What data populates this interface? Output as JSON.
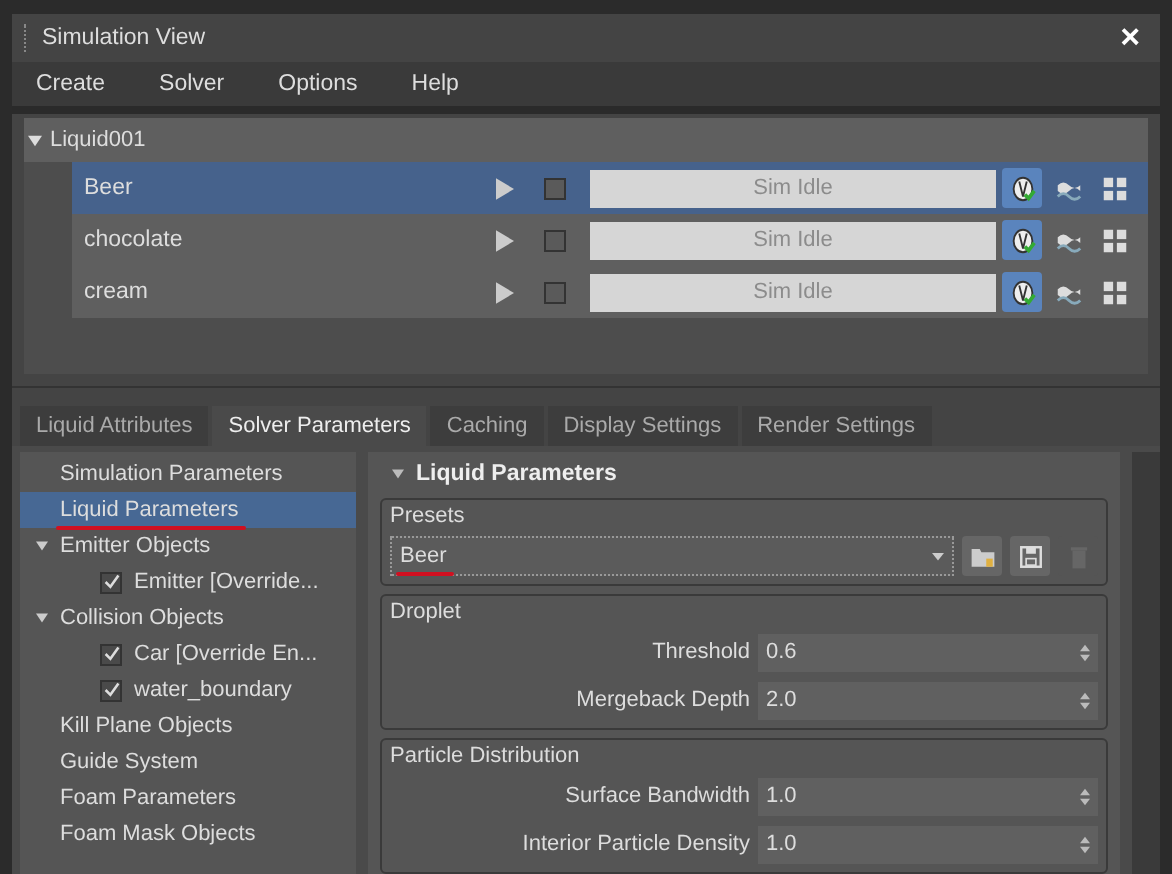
{
  "window": {
    "title": "Simulation View",
    "close": "×"
  },
  "menu": [
    "Create",
    "Solver",
    "Options",
    "Help"
  ],
  "tree": {
    "root": "Liquid001",
    "expanded": true,
    "rows": [
      {
        "name": "Beer",
        "selected": true,
        "checked": false,
        "status": "Sim Idle"
      },
      {
        "name": "chocolate",
        "selected": false,
        "checked": false,
        "status": "Sim Idle"
      },
      {
        "name": "cream",
        "selected": false,
        "checked": false,
        "status": "Sim Idle"
      }
    ]
  },
  "tabs": [
    {
      "label": "Liquid Attributes",
      "selected": false
    },
    {
      "label": "Solver Parameters",
      "selected": true
    },
    {
      "label": "Caching",
      "selected": false
    },
    {
      "label": "Display Settings",
      "selected": false
    },
    {
      "label": "Render Settings",
      "selected": false
    }
  ],
  "sidebar": {
    "items": [
      {
        "label": "Simulation Parameters",
        "selected": false,
        "underlined": false
      },
      {
        "label": "Liquid Parameters",
        "selected": true,
        "underlined": true
      },
      {
        "label": "Emitter Objects",
        "selected": false,
        "underlined": false,
        "expanded": true,
        "children": [
          {
            "label": "Emitter [Override...",
            "checked": true
          }
        ]
      },
      {
        "label": "Collision Objects",
        "selected": false,
        "underlined": false,
        "expanded": true,
        "children": [
          {
            "label": "Car [Override En...",
            "checked": true
          },
          {
            "label": "water_boundary",
            "checked": true
          }
        ]
      },
      {
        "label": "Kill Plane Objects",
        "selected": false,
        "underlined": false
      },
      {
        "label": "Guide System",
        "selected": false,
        "underlined": false
      },
      {
        "label": "Foam Parameters",
        "selected": false,
        "underlined": false
      },
      {
        "label": "Foam Mask Objects",
        "selected": false,
        "underlined": false
      }
    ]
  },
  "panel": {
    "title": "Liquid Parameters",
    "expanded": true,
    "presets": {
      "label": "Presets",
      "value": "Beer",
      "underlined": true
    },
    "groups": [
      {
        "label": "Droplet",
        "fields": [
          {
            "label": "Threshold",
            "value": "0.6"
          },
          {
            "label": "Mergeback Depth",
            "value": "2.0"
          }
        ]
      },
      {
        "label": "Particle Distribution",
        "fields": [
          {
            "label": "Surface Bandwidth",
            "value": "1.0"
          },
          {
            "label": "Interior Particle Density",
            "value": "1.0"
          }
        ]
      }
    ]
  }
}
